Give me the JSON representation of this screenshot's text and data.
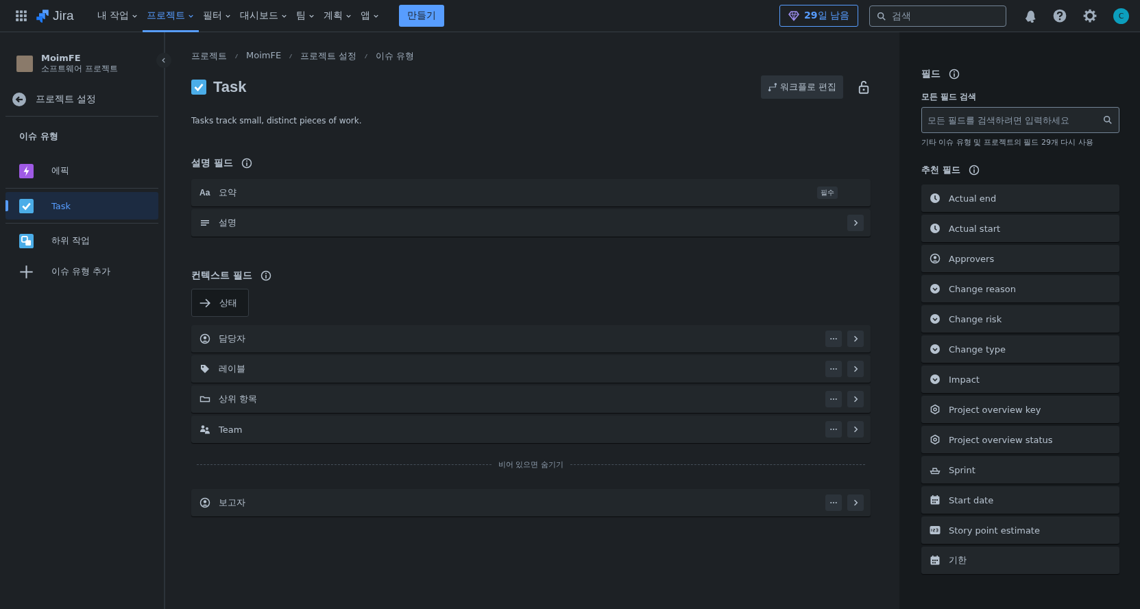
{
  "topbar": {
    "app_name": "Jira",
    "nav": [
      {
        "label": "내 작업",
        "selected": false
      },
      {
        "label": "프로젝트",
        "selected": true
      },
      {
        "label": "필터",
        "selected": false
      },
      {
        "label": "대시보드",
        "selected": false
      },
      {
        "label": "팀",
        "selected": false
      },
      {
        "label": "계획",
        "selected": false
      },
      {
        "label": "앱",
        "selected": false
      }
    ],
    "create_button": "만들기",
    "trial_badge": {
      "bold": "29",
      "rest": "일 남음"
    },
    "search": {
      "placeholder": "검색"
    },
    "avatar_initial": "C"
  },
  "sidebar": {
    "project_name": "MoimFE",
    "project_type": "소프트웨어 프로젝트",
    "back_link": "프로젝트 설정",
    "section_title": "이슈 유형",
    "items": [
      {
        "label": "에픽",
        "kind": "epic",
        "selected": false
      },
      {
        "label": "Task",
        "kind": "task",
        "selected": true
      },
      {
        "label": "하위 작업",
        "kind": "subtask",
        "selected": false
      },
      {
        "label": "이슈 유형 추가",
        "kind": "add",
        "selected": false
      }
    ]
  },
  "main": {
    "breadcrumbs": [
      "프로젝트",
      "MoimFE",
      "프로젝트 설정",
      "이슈 유형"
    ],
    "title": "Task",
    "workflow_button": "워크플로 편집",
    "description": "Tasks track small, distinct pieces of work.",
    "description_fields": {
      "heading": "설명 필드",
      "rows": [
        {
          "label": "요약",
          "kind": "text",
          "icon_label": "Aa",
          "badge": "필수",
          "menu": false,
          "expandable": false
        },
        {
          "label": "설명",
          "kind": "lines",
          "menu": false,
          "expandable": true
        }
      ]
    },
    "context_fields": {
      "heading": "컨텍스트 필드",
      "status_chip": "상태",
      "rows": [
        {
          "label": "담당자",
          "kind": "person",
          "menu": true,
          "expandable": true
        },
        {
          "label": "레이블",
          "kind": "tag",
          "menu": true,
          "expandable": true
        },
        {
          "label": "상위 항목",
          "kind": "parent",
          "menu": true,
          "expandable": true
        },
        {
          "label": "Team",
          "kind": "team",
          "menu": true,
          "expandable": true
        }
      ],
      "divider_label": "비어 있으면 숨기기",
      "hidden_rows": [
        {
          "label": "보고자",
          "kind": "person",
          "menu": true,
          "expandable": true
        }
      ]
    }
  },
  "fields_panel": {
    "heading": "필드",
    "search_label": "모든 필드 검색",
    "search_placeholder": "모든 필드를 검색하려면 입력하세요",
    "help_text": "기타 이슈 유형 및 프로젝트의 필드 29개 다시 사용",
    "suggested_heading": "추천 필드",
    "suggested": [
      {
        "label": "Actual end",
        "kind": "clock"
      },
      {
        "label": "Actual start",
        "kind": "clock"
      },
      {
        "label": "Approvers",
        "kind": "person"
      },
      {
        "label": "Change reason",
        "kind": "dropdown"
      },
      {
        "label": "Change risk",
        "kind": "dropdown"
      },
      {
        "label": "Change type",
        "kind": "dropdown"
      },
      {
        "label": "Impact",
        "kind": "dropdown"
      },
      {
        "label": "Project overview key",
        "kind": "hexagon"
      },
      {
        "label": "Project overview status",
        "kind": "hexagon"
      },
      {
        "label": "Sprint",
        "kind": "sprint"
      },
      {
        "label": "Start date",
        "kind": "calendar"
      },
      {
        "label": "Story point estimate",
        "kind": "number"
      },
      {
        "label": "기한",
        "kind": "calendar"
      }
    ]
  }
}
